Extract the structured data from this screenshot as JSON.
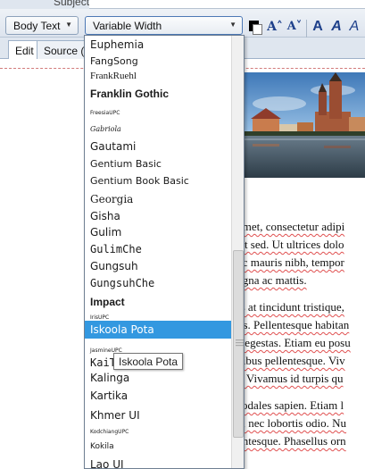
{
  "subject": {
    "label": "Subject:"
  },
  "toolbar": {
    "style_combo": "Body Text",
    "font_combo": "Variable Width",
    "grow_label": "A˄",
    "shrink_label": "A˅",
    "bold_label": "A",
    "italic_label": "A",
    "light_italic_label": "A",
    "icons": [
      "text-color-icon",
      "grow-font-icon",
      "shrink-font-icon"
    ]
  },
  "tabs": [
    {
      "label": "Edit"
    },
    {
      "label": "Source (HTML)"
    }
  ],
  "fonts": [
    {
      "name": "Euphemia"
    },
    {
      "name": "FangSong"
    },
    {
      "name": "FrankRuehl"
    },
    {
      "name": "Franklin Gothic"
    },
    {
      "name": "FreesiaUPC"
    },
    {
      "name": "Gabriola"
    },
    {
      "name": "Gautami"
    },
    {
      "name": "Gentium Basic"
    },
    {
      "name": "Gentium Book Basic"
    },
    {
      "name": "Georgia"
    },
    {
      "name": "Gisha"
    },
    {
      "name": "Gulim"
    },
    {
      "name": "GulimChe"
    },
    {
      "name": "Gungsuh"
    },
    {
      "name": "GungsuhChe"
    },
    {
      "name": "Impact"
    },
    {
      "name": "IrisUPC"
    },
    {
      "name": "Iskoola Pota"
    },
    {
      "name": "JasmineUPC"
    },
    {
      "name": "KaiTi"
    },
    {
      "name": "Kalinga"
    },
    {
      "name": "Kartika"
    },
    {
      "name": "Khmer UI"
    },
    {
      "name": "KodchiangUPC"
    },
    {
      "name": "Kokila"
    },
    {
      "name": "Lao UI"
    }
  ],
  "selected_font": "Iskoola Pota",
  "tooltip": "Iskoola Pota",
  "body_lines": [
    "amet, consectetur adipi",
    "rit sed. Ut ultrices dolo",
    "ec mauris nibh, tempor",
    "agna ac mattis.",
    "",
    "is at tincidunt tristique,",
    "us. Pellentesque habitan",
    "s egestas. Etiam eu posu",
    "cibus pellentesque. Viv",
    "t. Vivamus id turpis qu",
    "",
    "sodales sapien. Etiam l",
    "c, nec lobortis odio. Nu",
    "entesque. Phasellus orn"
  ],
  "colors": {
    "selection": "#3398e0",
    "spellcheck": "#e05050",
    "toolbar_icon": "#1d3f8a"
  }
}
